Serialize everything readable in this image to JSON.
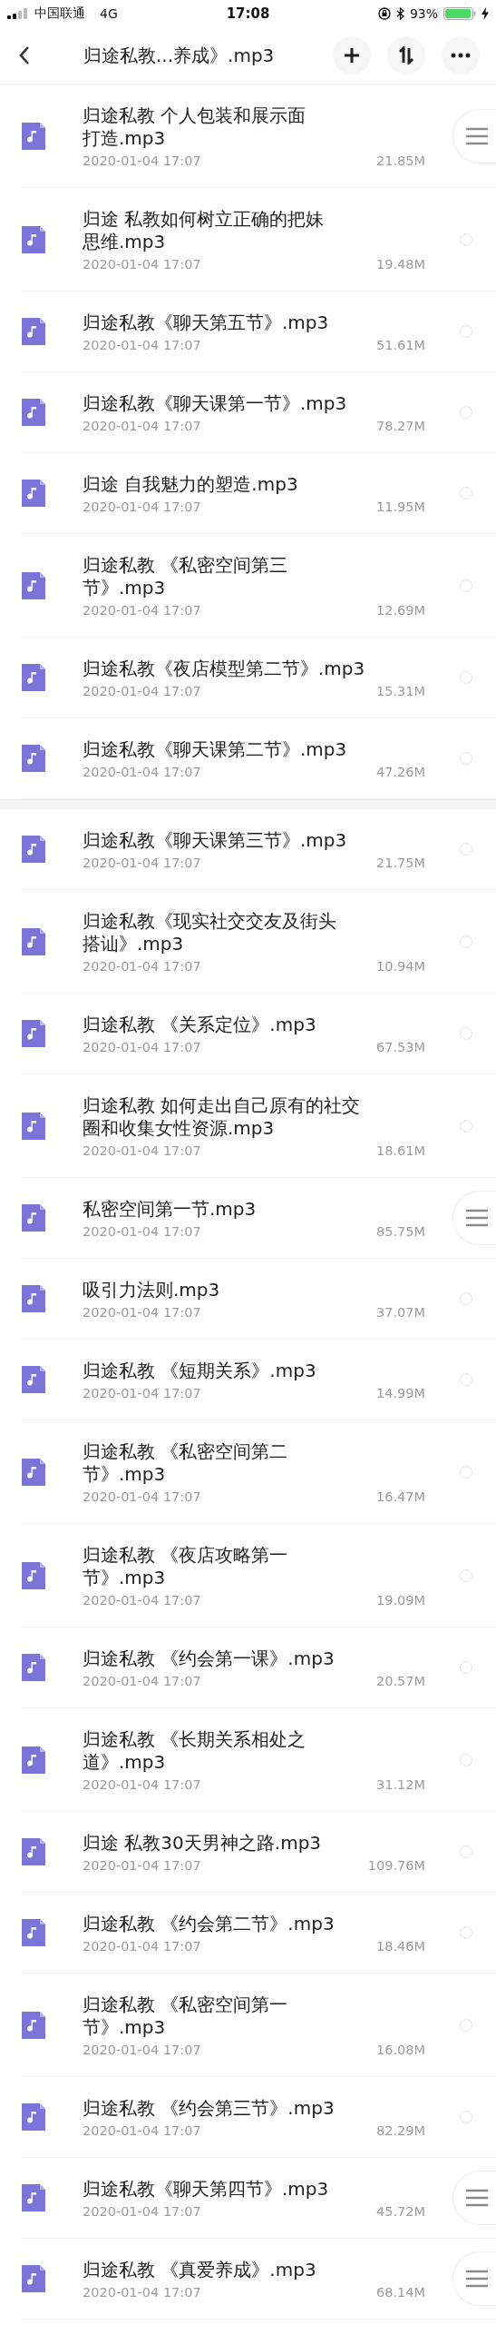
{
  "status_bar": {
    "carrier": "中国联通",
    "network": "4G",
    "time": "17:08",
    "battery": "93%"
  },
  "header": {
    "title": "归途私教...养成》.mp3"
  },
  "sections": [
    {
      "files": [
        {
          "name_lines": [
            "归途私教 个人包装和展示面",
            "打造.mp3"
          ],
          "date": "2020-01-04 17:07",
          "size": "21.85M",
          "kind": "handle"
        },
        {
          "name_lines": [
            "归途 私教如何树立正确的把妹",
            "思维.mp3"
          ],
          "date": "2020-01-04 17:07",
          "size": "19.48M",
          "kind": "radio"
        },
        {
          "name_lines": [
            "归途私教《聊天第五节》.mp3"
          ],
          "date": "2020-01-04 17:07",
          "size": "51.61M",
          "kind": "radio"
        },
        {
          "name_lines": [
            "归途私教《聊天课第一节》.mp3"
          ],
          "date": "2020-01-04 17:07",
          "size": "78.27M",
          "kind": "radio"
        },
        {
          "name_lines": [
            "归途 自我魅力的塑造.mp3"
          ],
          "date": "2020-01-04 17:07",
          "size": "11.95M",
          "kind": "radio"
        },
        {
          "name_lines": [
            "归途私教 《私密空间第三",
            "节》.mp3"
          ],
          "date": "2020-01-04 17:07",
          "size": "12.69M",
          "kind": "radio"
        },
        {
          "name_lines": [
            "归途私教《夜店模型第二节》.mp3"
          ],
          "date": "2020-01-04 17:07",
          "size": "15.31M",
          "kind": "radio"
        },
        {
          "name_lines": [
            "归途私教《聊天课第二节》.mp3"
          ],
          "date": "2020-01-04 17:07",
          "size": "47.26M",
          "kind": "radio"
        }
      ]
    },
    {
      "files": [
        {
          "name_lines": [
            "归途私教《聊天课第三节》.mp3"
          ],
          "date": "2020-01-04 17:07",
          "size": "21.75M",
          "kind": "radio"
        },
        {
          "name_lines": [
            "归途私教《现实社交交友及街头",
            "搭讪》.mp3"
          ],
          "date": "2020-01-04 17:07",
          "size": "10.94M",
          "kind": "radio"
        },
        {
          "name_lines": [
            "归途私教 《关系定位》.mp3"
          ],
          "date": "2020-01-04 17:07",
          "size": "67.53M",
          "kind": "radio"
        },
        {
          "name_lines": [
            "归途私教 如何走出自己原有的社交",
            "圈和收集女性资源.mp3"
          ],
          "date": "2020-01-04 17:07",
          "size": "18.61M",
          "kind": "radio"
        },
        {
          "name_lines": [
            "私密空间第一节.mp3"
          ],
          "date": "2020-01-04 17:07",
          "size": "85.75M",
          "kind": "handle"
        },
        {
          "name_lines": [
            "吸引力法则.mp3"
          ],
          "date": "2020-01-04 17:07",
          "size": "37.07M",
          "kind": "radio"
        },
        {
          "name_lines": [
            "归途私教 《短期关系》.mp3"
          ],
          "date": "2020-01-04 17:07",
          "size": "14.99M",
          "kind": "radio"
        },
        {
          "name_lines": [
            "归途私教 《私密空间第二",
            "节》.mp3"
          ],
          "date": "2020-01-04 17:07",
          "size": "16.47M",
          "kind": "radio"
        },
        {
          "name_lines": [
            "归途私教 《夜店攻略第一",
            "节》.mp3"
          ],
          "date": "2020-01-04 17:07",
          "size": "19.09M",
          "kind": "radio"
        },
        {
          "name_lines": [
            "归途私教 《约会第一课》.mp3"
          ],
          "date": "2020-01-04 17:07",
          "size": "20.57M",
          "kind": "radio"
        },
        {
          "name_lines": [
            "归途私教 《长期关系相处之",
            "道》.mp3"
          ],
          "date": "2020-01-04 17:07",
          "size": "31.12M",
          "kind": "radio"
        },
        {
          "name_lines": [
            "归途 私教30天男神之路.mp3"
          ],
          "date": "2020-01-04 17:07",
          "size": "109.76M",
          "kind": "radio"
        },
        {
          "name_lines": [
            "归途私教 《约会第二节》.mp3"
          ],
          "date": "2020-01-04 17:07",
          "size": "18.46M",
          "kind": "radio"
        },
        {
          "name_lines": [
            "归途私教 《私密空间第一",
            "节》.mp3"
          ],
          "date": "2020-01-04 17:07",
          "size": "16.08M",
          "kind": "radio"
        },
        {
          "name_lines": [
            "归途私教 《约会第三节》.mp3"
          ],
          "date": "2020-01-04 17:07",
          "size": "82.29M",
          "kind": "radio"
        },
        {
          "name_lines": [
            "归途私教《聊天第四节》.mp3"
          ],
          "date": "2020-01-04 17:07",
          "size": "45.72M",
          "kind": "handle"
        },
        {
          "name_lines": [
            "归途私教 《真爱养成》.mp3"
          ],
          "date": "2020-01-04 17:07",
          "size": "68.14M",
          "kind": "handle"
        }
      ]
    }
  ]
}
